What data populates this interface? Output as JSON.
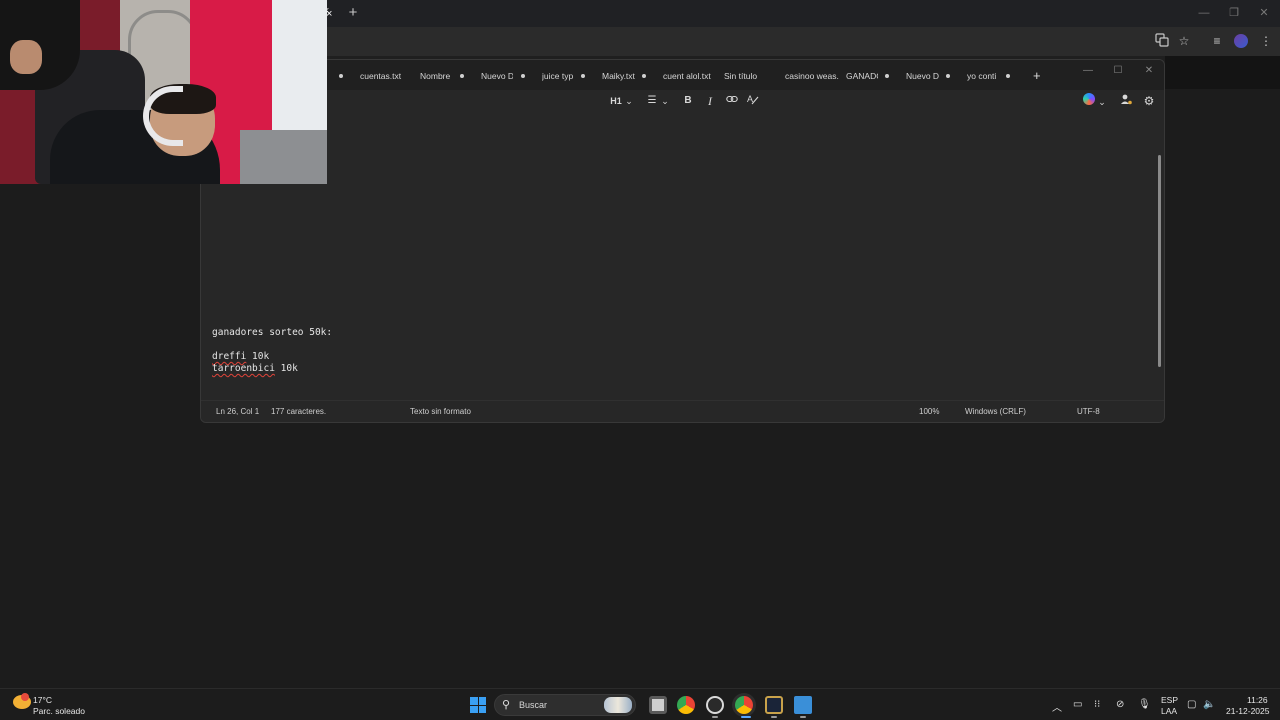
{
  "browser": {
    "close_glyph": "×",
    "newtab_glyph": "+",
    "min_glyph": "—",
    "max_glyph": "❐",
    "winclose_glyph": "✕",
    "toolbar_icons": [
      "translate-icon",
      "star-icon",
      "media-icon",
      "profile-icon",
      "menu-icon"
    ]
  },
  "notepad": {
    "tabs": [
      {
        "label": "cuentas.txt",
        "dot": false
      },
      {
        "label": "Nombre",
        "dot": true
      },
      {
        "label": "Nuevo D",
        "dot": true
      },
      {
        "label": "juice typ",
        "dot": true
      },
      {
        "label": "Maiky.txt",
        "dot": true
      },
      {
        "label": "cuent alol.txt",
        "dot": false
      },
      {
        "label": "Sin título",
        "dot": false
      },
      {
        "label": "casinoo weas.t",
        "dot": false
      },
      {
        "label": "GANADC",
        "dot": true
      },
      {
        "label": "Nuevo D",
        "dot": true
      },
      {
        "label": "yo conti",
        "dot": true
      }
    ],
    "add_tab": "+",
    "toolbar": {
      "heading": "H1",
      "heading_chevron": "⌄",
      "list_chevron": "⌄",
      "bold": "B",
      "italic": "I"
    },
    "content": {
      "line1": "ganadores sorteo 50k:",
      "line2_name": "dreffi",
      "line2_amount": " 10k",
      "line3_name": "tarroenbici",
      "line3_amount": " 10k"
    },
    "status": {
      "position": "Ln 26, Col 1",
      "chars": "177 caracteres.",
      "format": "Texto sin formato",
      "zoom": "100%",
      "line_endings": "Windows (CRLF)",
      "encoding": "UTF-8"
    }
  },
  "taskbar": {
    "temperature": "17°C",
    "weather": "Parc. soleado",
    "search_label": "Buscar",
    "language_top": "ESP",
    "language_bottom": "LAA",
    "time": "11:26",
    "date": "21-12-2025"
  }
}
